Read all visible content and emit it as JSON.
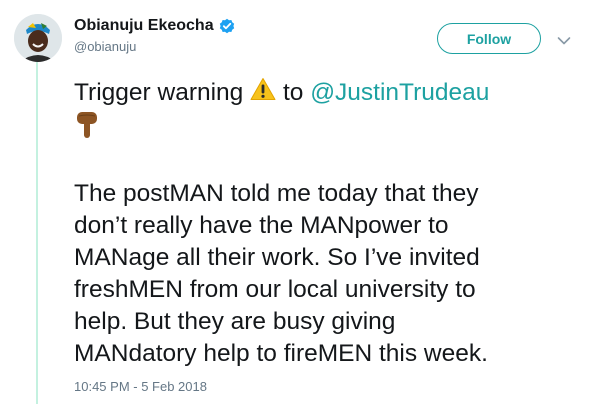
{
  "author": {
    "display_name": "Obianuju Ekeocha",
    "handle": "@obianuju",
    "verified": true
  },
  "follow_button": {
    "label": "Follow"
  },
  "tweet": {
    "intro_before": "Trigger warning",
    "intro_mid": "to",
    "mention": "@JustinTrudeau",
    "emoji_warning": "warning-icon",
    "emoji_point": "point-down-icon",
    "body_lines": [
      "The postMAN told me today that they",
      "don’t really have the MANpower to",
      "MANage all their work. So I’ve invited",
      "freshMEN from our local university to",
      "help. But they are busy giving",
      "MANdatory help to fireMEN this week."
    ]
  },
  "timestamp": "10:45 PM - 5 Feb 2018",
  "colors": {
    "accent": "#1da1a1",
    "verified": "#1da1f2",
    "muted": "#657786",
    "thread_line": "#c4f1e0"
  }
}
